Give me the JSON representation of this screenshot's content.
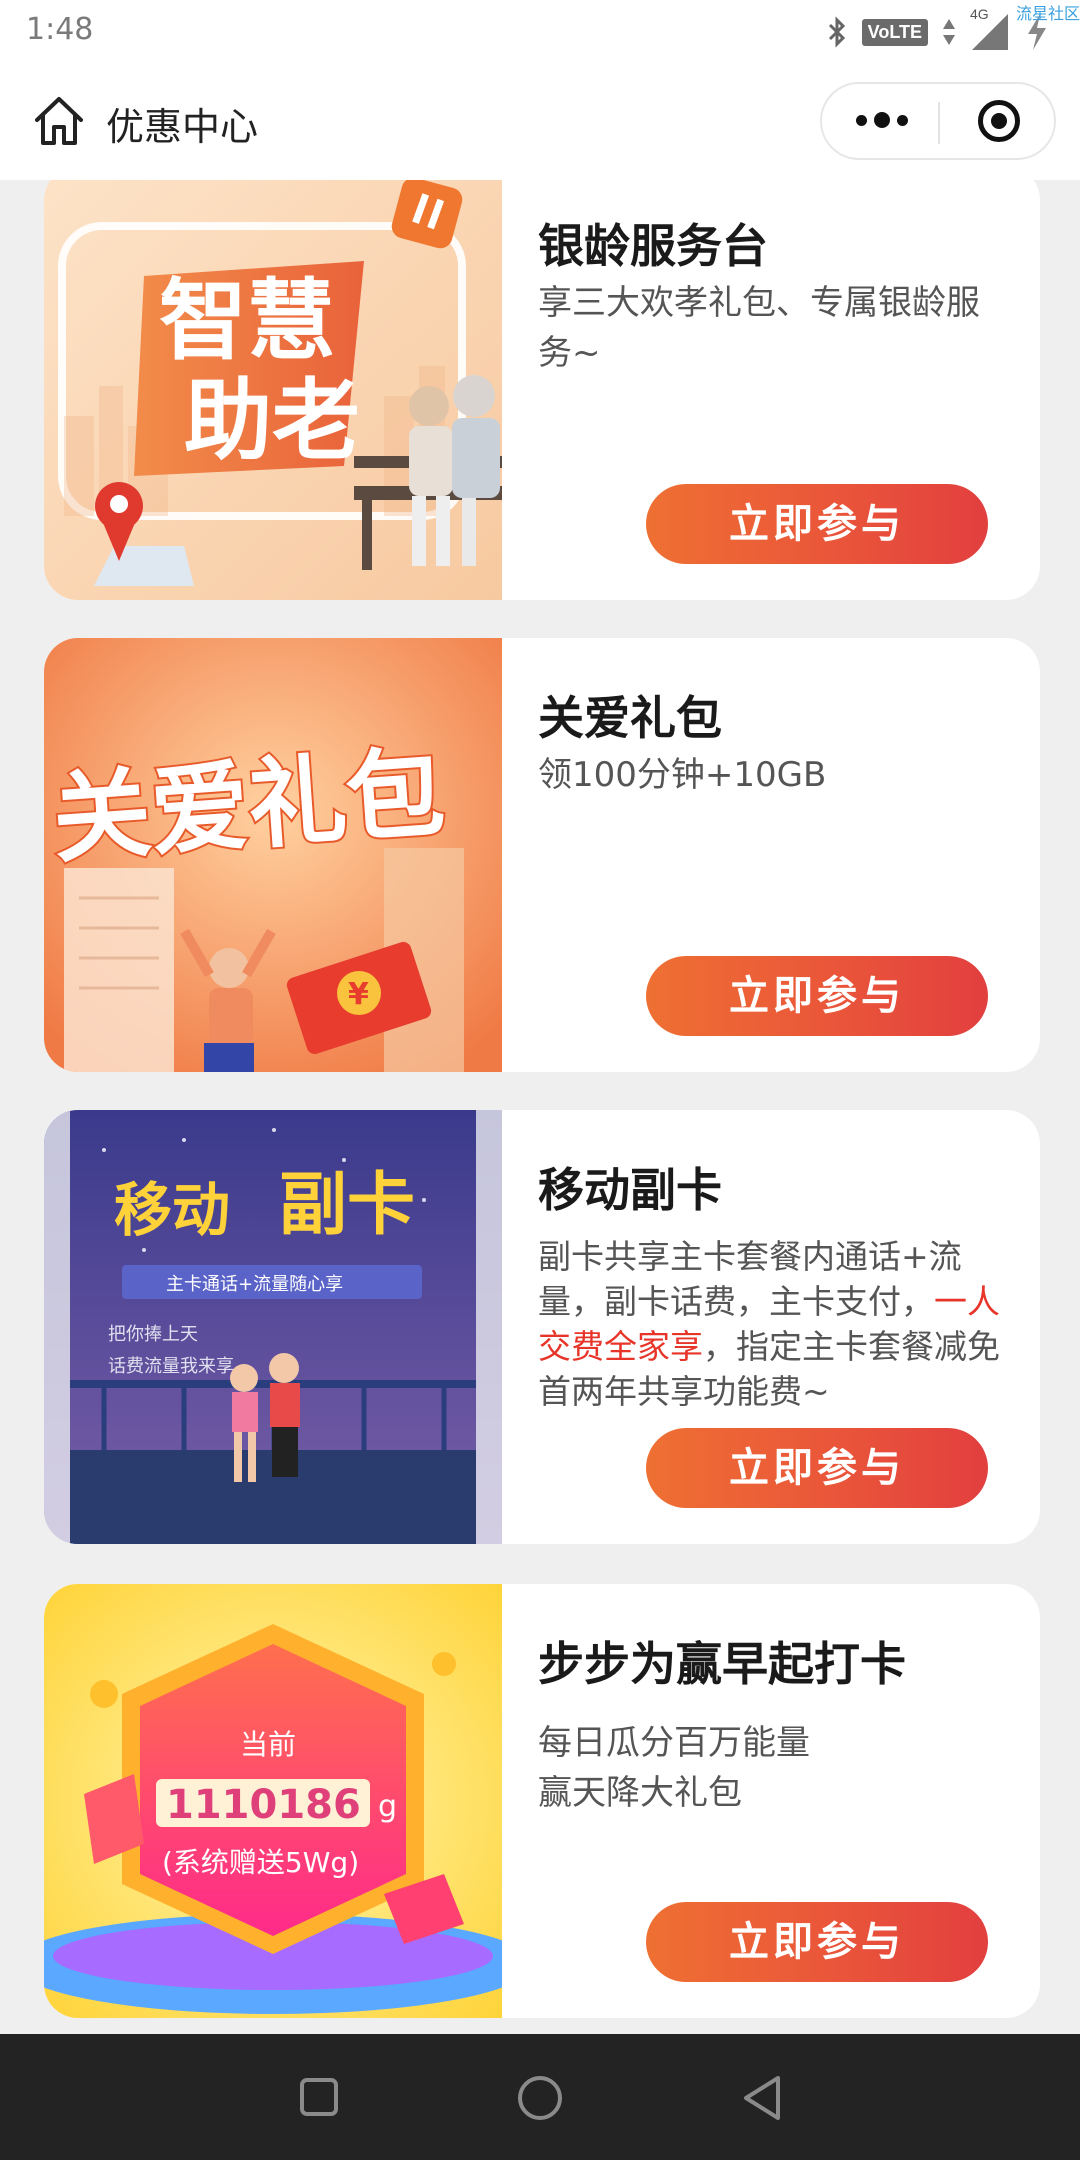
{
  "status_bar": {
    "time": "1:48",
    "volte": "VoLTE",
    "network": "4G",
    "watermark": "流星社区",
    "icons": [
      "bluetooth-icon",
      "volte-icon",
      "data-arrows-icon",
      "signal-icon",
      "charging-icon"
    ]
  },
  "title_bar": {
    "title": "优惠中心",
    "home_icon": "home-icon",
    "more_icon": "more-dots-icon",
    "close_icon": "target-close-icon"
  },
  "cards": [
    {
      "title": "银龄服务台",
      "desc": "享三大欢孝礼包、专属银龄服务~",
      "button": "立即参与",
      "image_text": [
        "智慧",
        "助老"
      ]
    },
    {
      "title": "关爱礼包",
      "desc": "领100分钟+10GB",
      "button": "立即参与",
      "image_text": [
        "关爱礼包",
        "¥"
      ]
    },
    {
      "title": "移动副卡",
      "desc_before": "副卡共享主卡套餐内通话+流量，副卡话费，主卡支付，",
      "desc_highlight": "一人交费全家享",
      "desc_after": "，指定主卡套餐减免首两年共享功能费~",
      "button": "立即参与",
      "image_text": [
        "移动",
        "副卡",
        "主卡通话+流量随心享",
        "把你捧上天",
        "话费流量我来享"
      ]
    },
    {
      "title": "步步为赢早起打卡",
      "desc_line1": "每日瓜分百万能量",
      "desc_line2": "赢天降大礼包",
      "button": "立即参与",
      "image_text": [
        "当前",
        "1110186",
        "g",
        "(系统赠送5Wg)"
      ]
    }
  ],
  "colors": {
    "accent": "#e9533a",
    "highlight": "#e8352a",
    "background": "#efefef"
  }
}
